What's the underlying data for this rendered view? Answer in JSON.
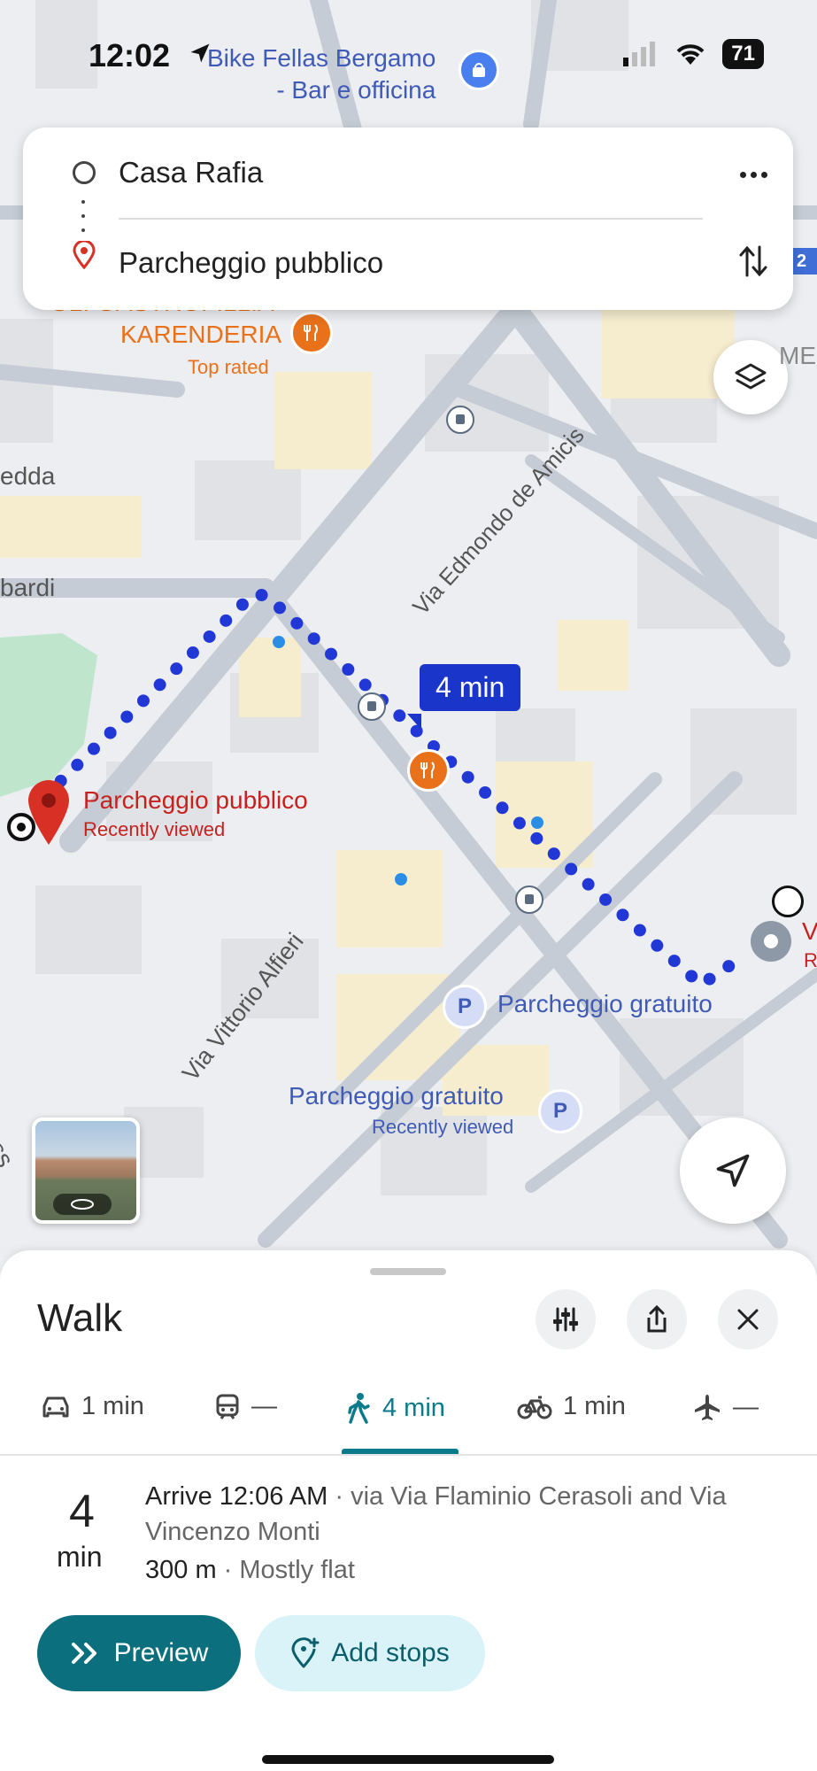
{
  "status_bar": {
    "time": "12:02",
    "battery": "71"
  },
  "route_card": {
    "origin": "Casa Rafia",
    "destination": "Parcheggio pubblico"
  },
  "map": {
    "poi_bike_shop_line1": "Bike Fellas Bergamo",
    "poi_bike_shop_line2": "- Bar e officina",
    "poi_restaurant_partial": "GLI GASTROFILLIA",
    "poi_restaurant": "KARENDERIA",
    "poi_restaurant_sub": "Top rated",
    "street_edda": "edda",
    "street_bardi": "bardi",
    "street_amicis": "Via Edmondo de Amicis",
    "street_alfieri": "Via Vittorio Alfieri",
    "street_oss": "oss",
    "edge_label_me": "ME",
    "edge_label_v": "V",
    "edge_label_r": "R",
    "edge_label_2": "2",
    "route_time_badge": "4 min",
    "dest_label": "Parcheggio pubblico",
    "dest_sub": "Recently viewed",
    "parking1": "Parcheggio gratuito",
    "parking2": "Parcheggio gratuito",
    "parking2_sub": "Recently viewed",
    "parking_symbol": "P",
    "colors": {
      "route": "#2138d6",
      "poi_red": "#c5221f",
      "poi_orange": "#e8711a",
      "poi_blue": "#3f5bb5",
      "park": "#bfe6cc"
    }
  },
  "sheet": {
    "title": "Walk",
    "modes": [
      {
        "icon": "car-icon",
        "label": "1 min"
      },
      {
        "icon": "train-icon",
        "label": "—"
      },
      {
        "icon": "walk-icon",
        "label": "4 min",
        "active": true
      },
      {
        "icon": "bike-icon",
        "label": "1 min"
      },
      {
        "icon": "plane-icon",
        "label": "—"
      }
    ],
    "duration_value": "4",
    "duration_unit": "min",
    "arrive": "Arrive 12:06 AM",
    "via": " · via Via Flaminio Cerasoli and Via Vincenzo Monti",
    "distance": "300 m",
    "terrain": " · Mostly flat",
    "preview_label": "Preview",
    "add_stops_label": "Add stops"
  }
}
